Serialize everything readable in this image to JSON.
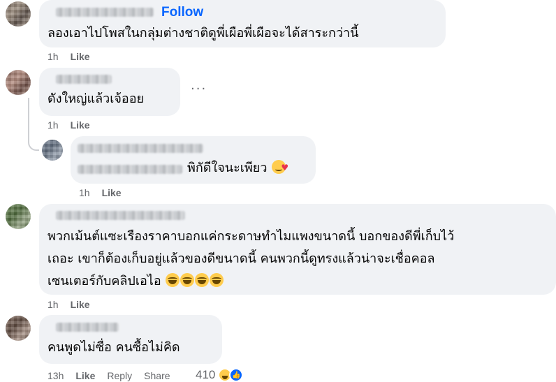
{
  "comments": [
    {
      "follow_label": "Follow",
      "text": "ลองเอาไปโพสในกลุ่มต่างชาติดูพี่เผือพี่เผือจะได้สาระกว่านี้",
      "time": "1h",
      "like_label": "Like"
    },
    {
      "text": "ดังใหญ่แล้วเจ้ออย",
      "time": "1h",
      "like_label": "Like",
      "more_label": "..."
    },
    {
      "text": "พิกัดีใจนะเพียว",
      "time": "1h",
      "like_label": "Like",
      "emoji": "smiling-face-with-hearts"
    },
    {
      "lines": [
        "พวกเม้นต์แซะเรืองราคาบอกแค่กระดาษทำไมแพงขนาดนี้ บอกของดีพี่เก็บไว้",
        "เถอะ เขาก็ต้องเก็บอยู่แล้วของดีขนาดนี้ คนพวกนี้ดูทรงแล้วน่าจะเชื่อคอล",
        "เซนเตอร์กับคลิปเอไอ"
      ],
      "emojis": [
        "laughing-face",
        "laughing-face",
        "laughing-face",
        "laughing-face"
      ],
      "time": "1h",
      "like_label": "Like"
    },
    {
      "text": "คนพูดไม่ซื่อ คนซื้อไม่คิด",
      "time": "13h",
      "like_label": "Like",
      "reply_label": "Reply",
      "share_label": "Share",
      "reaction_count": "410",
      "reaction_icons": [
        "haha-icon",
        "like-icon"
      ]
    }
  ]
}
